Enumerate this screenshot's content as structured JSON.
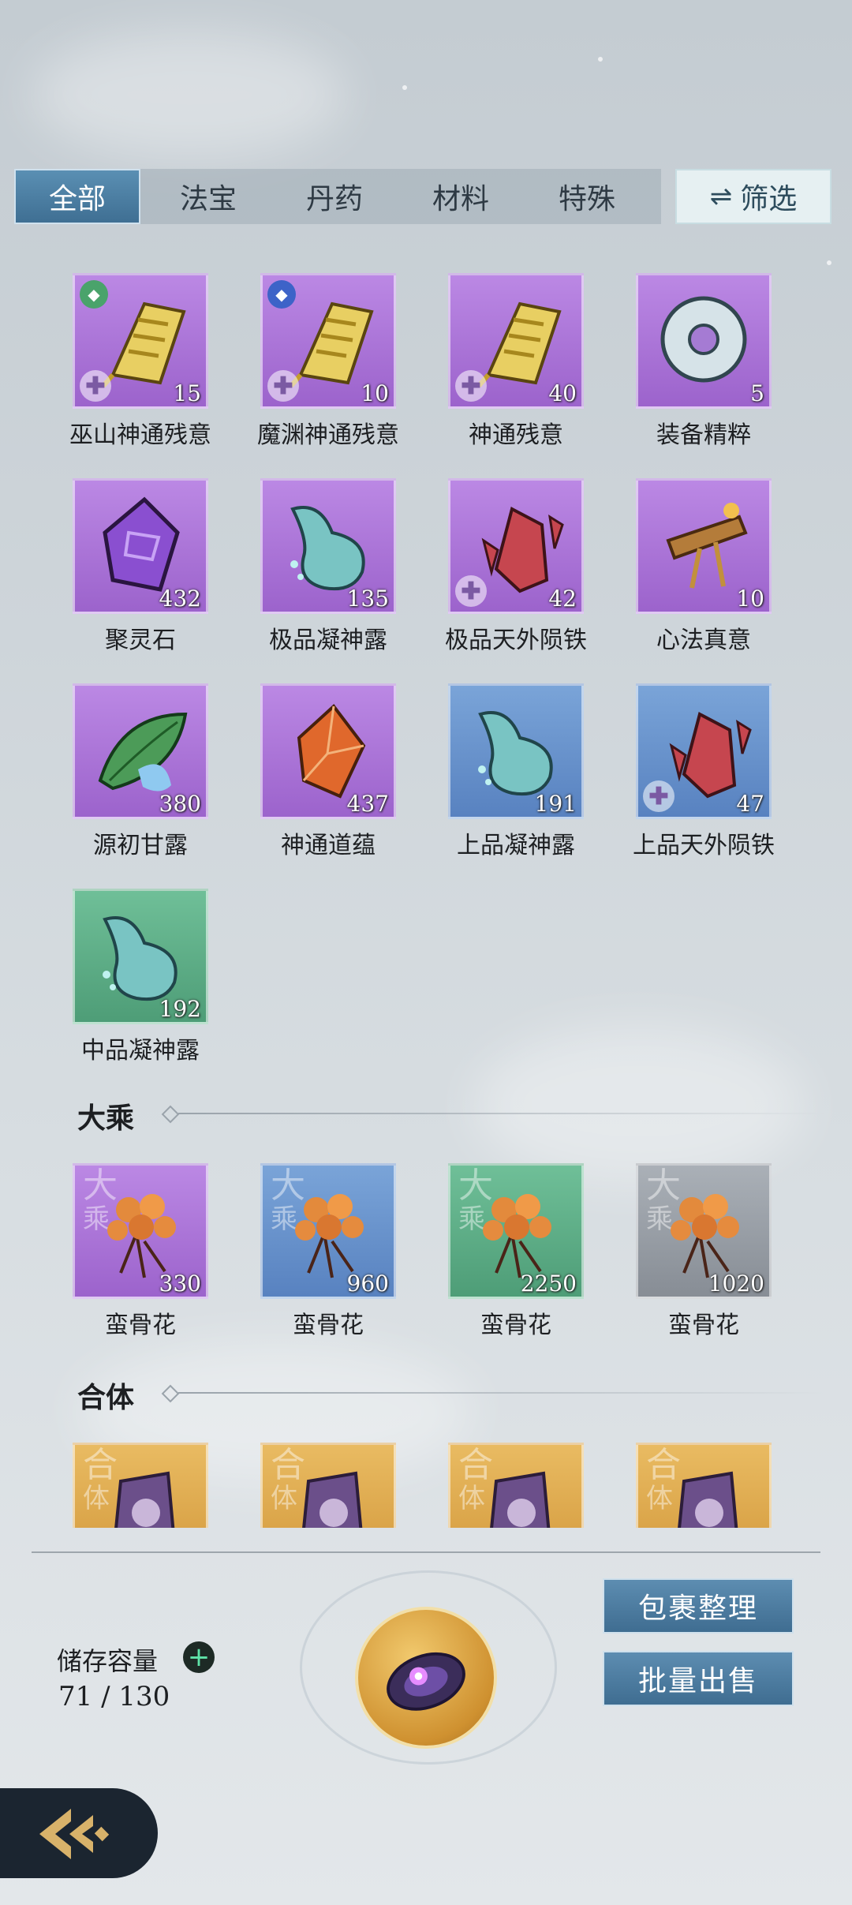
{
  "tabs": [
    {
      "label": "全部",
      "active": true
    },
    {
      "label": "法宝",
      "active": false
    },
    {
      "label": "丹药",
      "active": false
    },
    {
      "label": "材料",
      "active": false
    },
    {
      "label": "特殊",
      "active": false
    }
  ],
  "filter_label": "筛选",
  "items": [
    {
      "name": "巫山神通残意",
      "count": "15",
      "color": "purple",
      "icon": "golden-talisman-icon"
    },
    {
      "name": "魔渊神通残意",
      "count": "10",
      "color": "purple",
      "icon": "golden-talisman-icon"
    },
    {
      "name": "神通残意",
      "count": "40",
      "color": "purple",
      "icon": "golden-talisman-icon"
    },
    {
      "name": "装备精粹",
      "count": "5",
      "color": "purple",
      "icon": "jade-ring-icon"
    },
    {
      "name": "聚灵石",
      "count": "432",
      "color": "purple",
      "icon": "spirit-stone-icon"
    },
    {
      "name": "极品凝神露",
      "count": "135",
      "color": "purple",
      "icon": "dew-flask-icon"
    },
    {
      "name": "极品天外陨铁",
      "count": "42",
      "color": "purple",
      "icon": "meteor-iron-icon"
    },
    {
      "name": "心法真意",
      "count": "10",
      "color": "purple",
      "icon": "scroll-artifact-icon"
    },
    {
      "name": "源初甘露",
      "count": "380",
      "color": "purple",
      "icon": "leaf-dew-icon"
    },
    {
      "name": "神通道蕴",
      "count": "437",
      "color": "purple",
      "icon": "amber-crystal-icon"
    },
    {
      "name": "上品凝神露",
      "count": "191",
      "color": "blue",
      "icon": "dew-flask-icon"
    },
    {
      "name": "上品天外陨铁",
      "count": "47",
      "color": "blue",
      "icon": "meteor-iron-icon"
    },
    {
      "name": "中品凝神露",
      "count": "192",
      "color": "green",
      "icon": "dew-flask-icon"
    }
  ],
  "sections": [
    {
      "title": "大乘",
      "watermark": "大乘",
      "items": [
        {
          "name": "蛮骨花",
          "count": "330",
          "color": "purple"
        },
        {
          "name": "蛮骨花",
          "count": "960",
          "color": "blue"
        },
        {
          "name": "蛮骨花",
          "count": "2250",
          "color": "green"
        },
        {
          "name": "蛮骨花",
          "count": "1020",
          "color": "gray"
        }
      ]
    },
    {
      "title": "合体",
      "watermark": "合体",
      "items": [
        {
          "color": "gold"
        },
        {
          "color": "gold"
        },
        {
          "color": "gold"
        },
        {
          "color": "gold"
        }
      ]
    }
  ],
  "storage": {
    "label": "储存容量",
    "value": "71 / 130"
  },
  "buttons": {
    "organize": "包裹整理",
    "bulk_sell": "批量出售"
  }
}
